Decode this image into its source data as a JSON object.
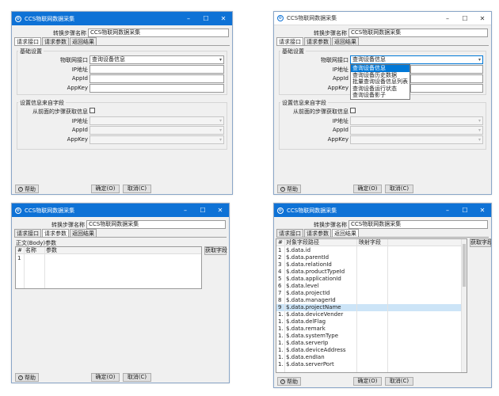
{
  "panel1": {
    "title": "CCS物联网数据采集",
    "step_name_label": "转换步骤名称",
    "step_name_value": "CCS物联网数据采集",
    "tabs": [
      "请求接口",
      "请求参数",
      "返回结果"
    ],
    "basic_group": "基础设置",
    "api_label": "物联网接口",
    "api_value": "查询设备信息",
    "ip_label": "IP地址",
    "appid_label": "AppId",
    "appkey_label": "AppKey",
    "prev_group": "设置信息来自字段",
    "from_prev_label": "从前面的步骤获取信息",
    "help_label": "帮助",
    "ok_label": "确定(O)",
    "cancel_label": "取消(C)"
  },
  "panel2": {
    "title": "CCS物联网数据采集",
    "step_name_label": "转换步骤名称",
    "step_name_value": "CCS物联网数据采集",
    "tabs": [
      "请求接口",
      "请求参数",
      "返回结果"
    ],
    "basic_group": "基础设置",
    "api_label": "物联网接口",
    "api_value": "查询设备信息",
    "ip_label": "IP地址",
    "appid_label": "AppId",
    "appkey_label": "AppKey",
    "dropdown_options": [
      "查询设备信息",
      "查询设备历史数据",
      "批量查询设备信息列表",
      "查询设备运行状态",
      "查询设备影子"
    ],
    "prev_group": "设置信息来自字段",
    "from_prev_label": "从前面的步骤获取信息",
    "help_label": "帮助",
    "ok_label": "确定(O)",
    "cancel_label": "取消(C)"
  },
  "panel3": {
    "title": "CCS物联网数据采集",
    "step_name_label": "转换步骤名称",
    "step_name_value": "CCS物联网数据采集",
    "tabs": [
      "请求接口",
      "请求参数",
      "返回结果"
    ],
    "section_label": "正文(Body)参数",
    "columns": [
      "#",
      "名称",
      "参数"
    ],
    "rows": [
      "1"
    ],
    "get_fields_label": "获取字段",
    "help_label": "帮助",
    "ok_label": "确定(O)",
    "cancel_label": "取消(C)"
  },
  "panel4": {
    "title": "CCS物联网数据采集",
    "step_name_label": "转换步骤名称",
    "step_name_value": "CCS物联网数据采集",
    "tabs": [
      "请求接口",
      "请求参数",
      "返回结果"
    ],
    "columns": [
      "#",
      "对象字段路径",
      "映射字段"
    ],
    "rows": [
      {
        "n": "1",
        "path": "$.data.id"
      },
      {
        "n": "2",
        "path": "$.data.parentId"
      },
      {
        "n": "3",
        "path": "$.data.relationId"
      },
      {
        "n": "4",
        "path": "$.data.productTypeId"
      },
      {
        "n": "5",
        "path": "$.data.applicationId"
      },
      {
        "n": "6",
        "path": "$.data.level"
      },
      {
        "n": "7",
        "path": "$.data.projectId"
      },
      {
        "n": "8",
        "path": "$.data.managerId"
      },
      {
        "n": "9",
        "path": "$.data.projectName"
      },
      {
        "n": "1.",
        "path": "$.data.deviceVender"
      },
      {
        "n": "1.",
        "path": "$.data.delFlag"
      },
      {
        "n": "1.",
        "path": "$.data.remark"
      },
      {
        "n": "1.",
        "path": "$.data.systemType"
      },
      {
        "n": "1.",
        "path": "$.data.serverIp"
      },
      {
        "n": "1.",
        "path": "$.data.deviceAddress"
      },
      {
        "n": "1.",
        "path": "$.data.endIan"
      },
      {
        "n": "1.",
        "path": "$.data.serverPort"
      }
    ],
    "selected_row": 8,
    "get_fields_label": "获取字段",
    "help_label": "帮助",
    "ok_label": "确定(O)",
    "cancel_label": "取消(C)"
  },
  "colors": {
    "titlebar_blue": "#0e72d6",
    "selection_blue": "#0078d7",
    "row_selected": "#cce4f7"
  }
}
